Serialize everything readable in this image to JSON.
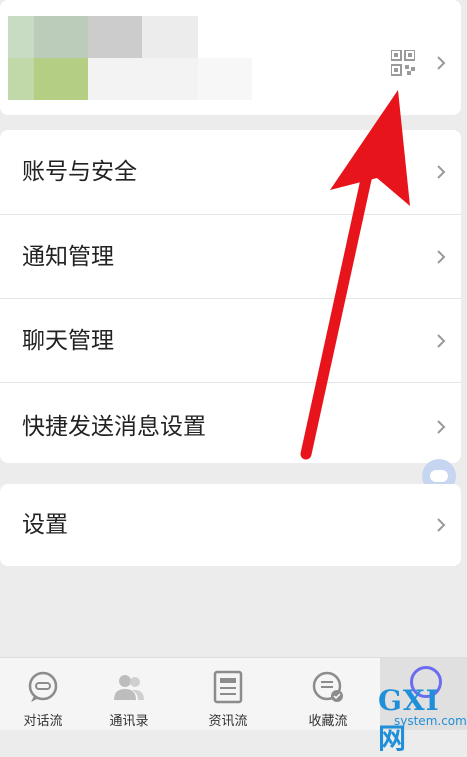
{
  "profile": {
    "qr_icon": "qr-code-icon",
    "chevron_icon": "chevron-right-icon"
  },
  "menu": {
    "items": [
      {
        "label": "账号与安全"
      },
      {
        "label": "通知管理"
      },
      {
        "label": "聊天管理"
      },
      {
        "label": "快捷发送消息设置"
      }
    ]
  },
  "settings": {
    "label": "设置"
  },
  "tabbar": {
    "tabs": [
      {
        "label": "对话流",
        "icon": "chat-bubble-icon"
      },
      {
        "label": "通讯录",
        "icon": "contacts-icon"
      },
      {
        "label": "资讯流",
        "icon": "news-icon"
      },
      {
        "label": "收藏流",
        "icon": "favorites-icon"
      }
    ]
  },
  "watermark": {
    "main": "GXI网",
    "sub": "system.com"
  },
  "colors": {
    "arrow": "#e8141b",
    "background": "#ececec",
    "card": "#ffffff",
    "accent": "#6c6cf0"
  }
}
